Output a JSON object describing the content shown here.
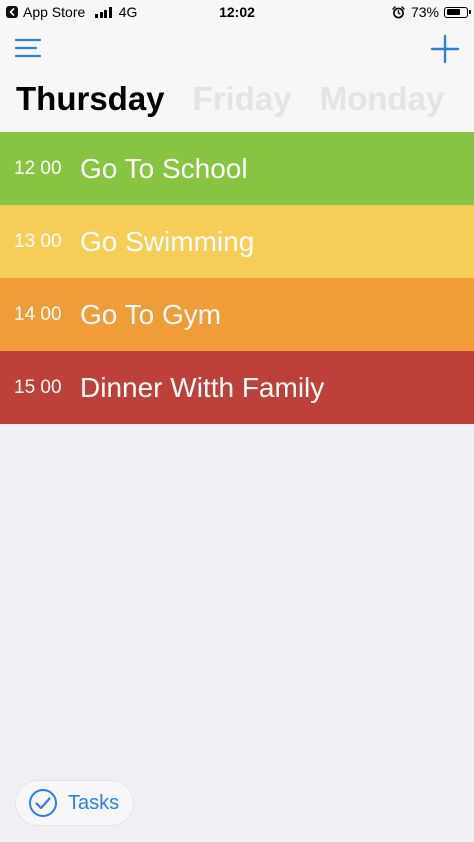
{
  "status_bar": {
    "carrier": "App Store",
    "network": "4G",
    "time": "12:02",
    "battery": "73%",
    "battery_level": 0.73,
    "icons": [
      "back-arrow-icon",
      "signal-icon",
      "alarm-icon",
      "battery-icon"
    ]
  },
  "header": {
    "menu_icon": "hamburger-menu-icon",
    "add_icon": "plus-icon",
    "accent_color": "#2f7ee8"
  },
  "days": [
    {
      "label": "Thursday",
      "active": true
    },
    {
      "label": "Friday",
      "active": false
    },
    {
      "label": "Monday",
      "active": false
    }
  ],
  "tasks": [
    {
      "time": "12 00",
      "title": "Go To School",
      "color": "#86c441"
    },
    {
      "time": "13 00",
      "title": "Go Swimming",
      "color": "#f6cd57"
    },
    {
      "time": "14 00",
      "title": "Go To Gym",
      "color": "#f09d39"
    },
    {
      "time": "15 00",
      "title": "Dinner Witth Family",
      "color": "#bd403b"
    }
  ],
  "footer": {
    "tasks_label": "Tasks",
    "tasks_icon": "checkmark-circle-icon"
  }
}
